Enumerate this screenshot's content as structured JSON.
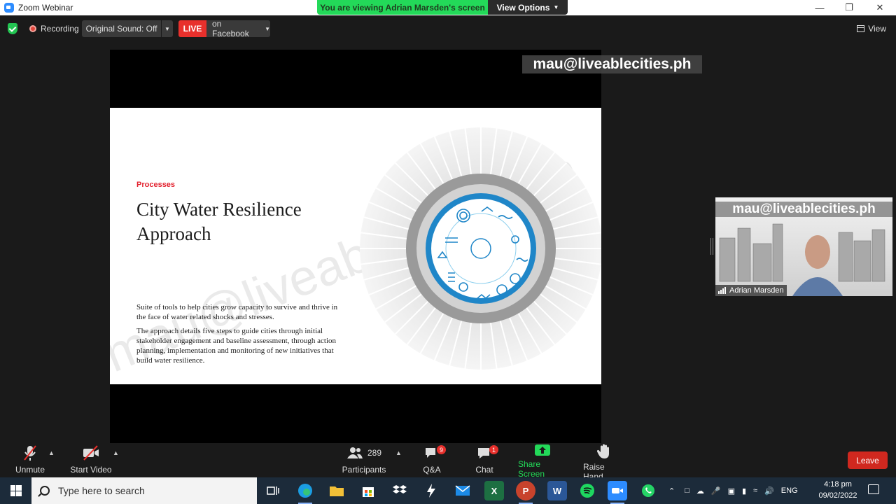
{
  "window": {
    "title": "Zoom Webinar",
    "banner_text": "You are viewing Adrian Marsden's screen",
    "view_options": "View Options"
  },
  "meeting_bar": {
    "recording": "Recording",
    "original_sound": "Original Sound: Off",
    "live": "LIVE",
    "live_target": "on Facebook",
    "view": "View"
  },
  "share": {
    "email_watermark": "mau@liveablecities.ph",
    "slide": {
      "label": "Processes",
      "title": "City Water Resilience Approach",
      "para1": "Suite of tools to help cities grow capacity to survive and thrive in the face of water related shocks and stresses.",
      "para2": "The approach details five steps to guide cities through initial stakeholder engagement and baseline assessment, through action planning, implementation and monitoring of new initiatives that build water resilience.",
      "watermark": "mau@liveablecities.ph"
    }
  },
  "participant": {
    "email": "mau@liveablecities.ph",
    "name": "Adrian Marsden"
  },
  "toolbar": {
    "unmute": "Unmute",
    "start_video": "Start Video",
    "participants_count": "289",
    "participants": "Participants",
    "qa": "Q&A",
    "qa_badge": "9",
    "chat": "Chat",
    "chat_badge": "1",
    "share_screen": "Share Screen",
    "raise_hand": "Raise Hand",
    "leave": "Leave"
  },
  "taskbar": {
    "search_placeholder": "Type here to search",
    "lang": "ENG",
    "time": "4:18 pm",
    "date": "09/02/2022"
  },
  "colors": {
    "live_red": "#e8302c",
    "share_green": "#23d959",
    "leave_red": "#d0281f"
  }
}
